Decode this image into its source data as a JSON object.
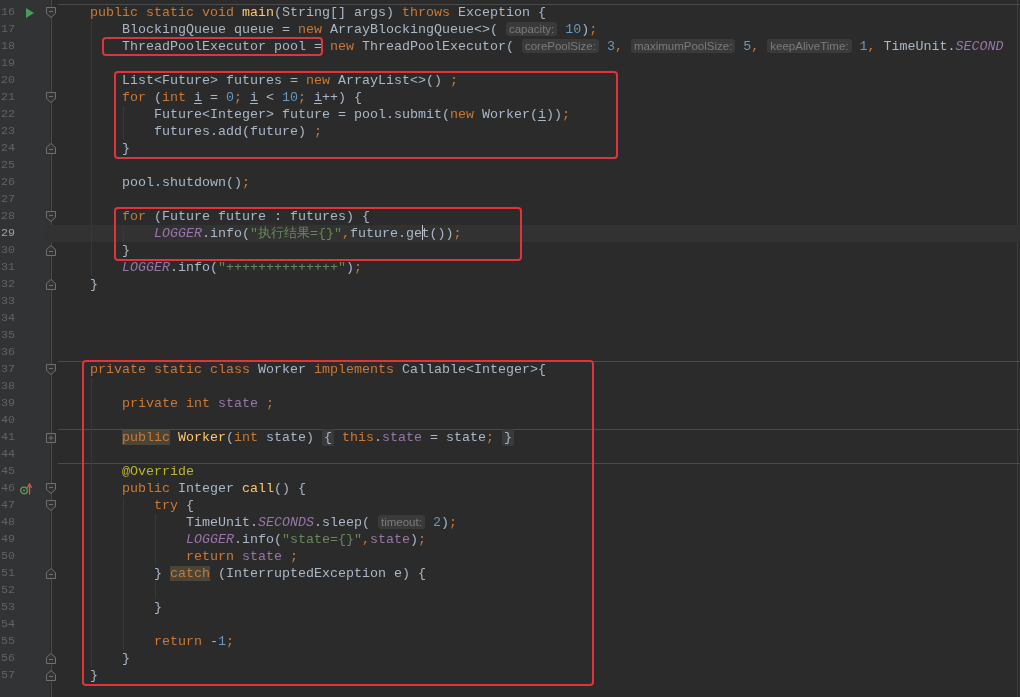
{
  "editor": {
    "lines": [
      {
        "kind": "line",
        "number": "16",
        "separator_above": true,
        "gutter_marker": {
          "kind": "run"
        },
        "fold_marker": {
          "kind": "start"
        },
        "tokens": [
          {
            "text": "public static void ",
            "kind": "keyword"
          },
          {
            "text": "main",
            "kind": "method"
          },
          {
            "text": "(String[] args) ",
            "kind": "plain"
          },
          {
            "text": "throws",
            "kind": "keyword"
          },
          {
            "text": " Exception {",
            "kind": "plain"
          }
        ],
        "children": [
          {
            "kind": "line",
            "number": "17",
            "tokens": [
              {
                "text": "BlockingQueue queue = ",
                "kind": "plain"
              },
              {
                "text": "new",
                "kind": "keyword"
              },
              {
                "text": " ArrayBlockingQueue<>( ",
                "kind": "plain"
              },
              {
                "text": "capacity:",
                "kind": "hint"
              },
              {
                "text": " 10",
                "kind": "number"
              },
              {
                "text": ")",
                "kind": "plain"
              },
              {
                "text": ";",
                "kind": "punct"
              }
            ]
          },
          {
            "kind": "line",
            "number": "18",
            "tokens": [
              {
                "text": "ThreadPoolExecutor pool =",
                "kind": "plain",
                "framed": true
              },
              {
                "text": " new",
                "kind": "keyword"
              },
              {
                "text": " ThreadPoolExecutor( ",
                "kind": "plain"
              },
              {
                "text": "corePoolSize:",
                "kind": "hint"
              },
              {
                "text": " 3",
                "kind": "number"
              },
              {
                "text": ", ",
                "kind": "punct"
              },
              {
                "text": "maximumPoolSize:",
                "kind": "hint"
              },
              {
                "text": " 5",
                "kind": "number"
              },
              {
                "text": ", ",
                "kind": "punct"
              },
              {
                "text": "keepAliveTime:",
                "kind": "hint"
              },
              {
                "text": " 1",
                "kind": "number"
              },
              {
                "text": ",",
                "kind": "punct"
              },
              {
                "text": " TimeUnit.",
                "kind": "plain"
              },
              {
                "text": "SECOND",
                "kind": "static"
              }
            ]
          },
          {
            "kind": "line",
            "number": "19"
          },
          {
            "kind": "frame",
            "children": [
              {
                "kind": "line",
                "number": "20",
                "tokens": [
                  {
                    "text": "List<Future> futures = ",
                    "kind": "plain"
                  },
                  {
                    "text": "new",
                    "kind": "keyword"
                  },
                  {
                    "text": " ArrayList<>() ",
                    "kind": "plain"
                  },
                  {
                    "text": ";",
                    "kind": "punct"
                  }
                ]
              },
              {
                "kind": "line",
                "number": "21",
                "fold_marker": {
                  "kind": "start"
                },
                "tokens": [
                  {
                    "text": "for",
                    "kind": "keyword"
                  },
                  {
                    "text": " (",
                    "kind": "plain"
                  },
                  {
                    "text": "int ",
                    "kind": "keyword"
                  },
                  {
                    "text": "i",
                    "kind": "reassigned"
                  },
                  {
                    "text": " = ",
                    "kind": "plain"
                  },
                  {
                    "text": "0",
                    "kind": "number"
                  },
                  {
                    "text": "; ",
                    "kind": "punct"
                  },
                  {
                    "text": "i",
                    "kind": "reassigned"
                  },
                  {
                    "text": " < ",
                    "kind": "plain"
                  },
                  {
                    "text": "10",
                    "kind": "number"
                  },
                  {
                    "text": "; ",
                    "kind": "punct"
                  },
                  {
                    "text": "i",
                    "kind": "reassigned"
                  },
                  {
                    "text": "++) {",
                    "kind": "plain"
                  }
                ],
                "children": [
                  {
                    "kind": "line",
                    "number": "22",
                    "tokens": [
                      {
                        "text": "Future<Integer> future = pool.submit(",
                        "kind": "plain"
                      },
                      {
                        "text": "new",
                        "kind": "keyword"
                      },
                      {
                        "text": " Worker(",
                        "kind": "plain"
                      },
                      {
                        "text": "i",
                        "kind": "reassigned"
                      },
                      {
                        "text": "))",
                        "kind": "plain"
                      },
                      {
                        "text": ";",
                        "kind": "punct"
                      }
                    ]
                  },
                  {
                    "kind": "line",
                    "number": "23",
                    "tokens": [
                      {
                        "text": "futures.add(future) ",
                        "kind": "plain"
                      },
                      {
                        "text": ";",
                        "kind": "punct"
                      }
                    ]
                  }
                ]
              },
              {
                "kind": "line",
                "number": "24",
                "fold_marker": {
                  "kind": "end"
                },
                "tokens": [
                  {
                    "text": "}",
                    "kind": "plain"
                  }
                ]
              }
            ]
          },
          {
            "kind": "line",
            "number": "25"
          },
          {
            "kind": "line",
            "number": "26",
            "tokens": [
              {
                "text": "pool.shutdown()",
                "kind": "plain"
              },
              {
                "text": ";",
                "kind": "punct"
              }
            ]
          },
          {
            "kind": "line",
            "number": "27"
          },
          {
            "kind": "frame",
            "children": [
              {
                "kind": "line",
                "number": "28",
                "fold_marker": {
                  "kind": "start"
                },
                "tokens": [
                  {
                    "text": "for",
                    "kind": "keyword"
                  },
                  {
                    "text": " (Future future : futures) {",
                    "kind": "plain"
                  }
                ],
                "children": [
                  {
                    "kind": "line",
                    "number": "29",
                    "current": true,
                    "tokens": [
                      {
                        "text": "LOGGER",
                        "kind": "static"
                      },
                      {
                        "text": ".info(",
                        "kind": "plain"
                      },
                      {
                        "text": "\"执行结果={}\"",
                        "kind": "string"
                      },
                      {
                        "text": ",",
                        "kind": "punct"
                      },
                      {
                        "text": "future.ge",
                        "kind": "plain"
                      },
                      {
                        "kind": "caret"
                      },
                      {
                        "text": "t())",
                        "kind": "plain"
                      },
                      {
                        "text": ";",
                        "kind": "punct"
                      }
                    ]
                  }
                ]
              },
              {
                "kind": "line",
                "number": "30",
                "fold_marker": {
                  "kind": "end"
                },
                "tokens": [
                  {
                    "text": "}",
                    "kind": "plain"
                  }
                ]
              }
            ]
          },
          {
            "kind": "line",
            "number": "31",
            "tokens": [
              {
                "text": "LOGGER",
                "kind": "static"
              },
              {
                "text": ".info(",
                "kind": "plain"
              },
              {
                "text": "\"++++++++++++++\"",
                "kind": "string"
              },
              {
                "text": ")",
                "kind": "plain"
              },
              {
                "text": ";",
                "kind": "punct"
              }
            ]
          }
        ]
      },
      {
        "kind": "line",
        "number": "32",
        "fold_marker": {
          "kind": "end"
        },
        "tokens": [
          {
            "text": "}",
            "kind": "plain"
          }
        ]
      },
      {
        "kind": "line",
        "number": "33"
      },
      {
        "kind": "line",
        "number": "34"
      },
      {
        "kind": "line",
        "number": "35"
      },
      {
        "kind": "line",
        "number": "36"
      },
      {
        "kind": "frame",
        "children": [
          {
            "kind": "line",
            "number": "37",
            "separator_above": true,
            "fold_marker": {
              "kind": "start"
            },
            "tokens": [
              {
                "text": "private static class ",
                "kind": "keyword"
              },
              {
                "text": "Worker ",
                "kind": "plain"
              },
              {
                "text": "implements",
                "kind": "keyword"
              },
              {
                "text": " Callable<Integer>{",
                "kind": "plain"
              }
            ],
            "children": [
              {
                "kind": "line",
                "number": "38"
              },
              {
                "kind": "line",
                "number": "39",
                "tokens": [
                  {
                    "text": "private int ",
                    "kind": "keyword"
                  },
                  {
                    "text": "state",
                    "kind": "field"
                  },
                  {
                    "text": " ;",
                    "kind": "punct"
                  }
                ]
              },
              {
                "kind": "line",
                "number": "40"
              },
              {
                "kind": "line",
                "number": "41",
                "separator_above": true,
                "fold_marker": {
                  "kind": "collapsed"
                },
                "tokens": [
                  {
                    "text": "public",
                    "kind": "keyword",
                    "highlighted": true
                  },
                  {
                    "text": " Worker",
                    "kind": "method"
                  },
                  {
                    "text": "(",
                    "kind": "plain"
                  },
                  {
                    "text": "int",
                    "kind": "keyword"
                  },
                  {
                    "text": " state) ",
                    "kind": "plain"
                  },
                  {
                    "text": "{",
                    "kind": "fold"
                  },
                  {
                    "text": " this",
                    "kind": "keyword"
                  },
                  {
                    "text": ".",
                    "kind": "plain"
                  },
                  {
                    "text": "state",
                    "kind": "field"
                  },
                  {
                    "text": " = state",
                    "kind": "plain"
                  },
                  {
                    "text": "; ",
                    "kind": "punct"
                  },
                  {
                    "text": "}",
                    "kind": "fold"
                  }
                ]
              },
              {
                "kind": "line",
                "number": "44"
              },
              {
                "kind": "line",
                "number": "45",
                "separator_above": true,
                "tokens": [
                  {
                    "text": "@Override",
                    "kind": "annotation"
                  }
                ]
              },
              {
                "kind": "line",
                "number": "46",
                "gutter_marker": {
                  "kind": "override"
                },
                "fold_marker": {
                  "kind": "start"
                },
                "tokens": [
                  {
                    "text": "public",
                    "kind": "keyword"
                  },
                  {
                    "text": " Integer ",
                    "kind": "plain"
                  },
                  {
                    "text": "call",
                    "kind": "method"
                  },
                  {
                    "text": "() {",
                    "kind": "plain"
                  }
                ],
                "children": [
                  {
                    "kind": "line",
                    "number": "47",
                    "fold_marker": {
                      "kind": "start"
                    },
                    "tokens": [
                      {
                        "text": "try",
                        "kind": "keyword"
                      },
                      {
                        "text": " {",
                        "kind": "plain"
                      }
                    ],
                    "children": [
                      {
                        "kind": "line",
                        "number": "48",
                        "tokens": [
                          {
                            "text": "TimeUnit.",
                            "kind": "plain"
                          },
                          {
                            "text": "SECONDS",
                            "kind": "static"
                          },
                          {
                            "text": ".sleep( ",
                            "kind": "plain"
                          },
                          {
                            "text": "timeout:",
                            "kind": "hint"
                          },
                          {
                            "text": " 2",
                            "kind": "number"
                          },
                          {
                            "text": ")",
                            "kind": "plain"
                          },
                          {
                            "text": ";",
                            "kind": "punct"
                          }
                        ]
                      },
                      {
                        "kind": "line",
                        "number": "49",
                        "tokens": [
                          {
                            "text": "LOGGER",
                            "kind": "static"
                          },
                          {
                            "text": ".info(",
                            "kind": "plain"
                          },
                          {
                            "text": "\"state={}\"",
                            "kind": "string"
                          },
                          {
                            "text": ",",
                            "kind": "punct"
                          },
                          {
                            "text": "state",
                            "kind": "field"
                          },
                          {
                            "text": ")",
                            "kind": "plain"
                          },
                          {
                            "text": ";",
                            "kind": "punct"
                          }
                        ]
                      },
                      {
                        "kind": "line",
                        "number": "50",
                        "tokens": [
                          {
                            "text": "return ",
                            "kind": "keyword"
                          },
                          {
                            "text": "state",
                            "kind": "field"
                          },
                          {
                            "text": " ;",
                            "kind": "punct"
                          }
                        ]
                      }
                    ]
                  },
                  {
                    "kind": "line",
                    "number": "51",
                    "fold_marker": {
                      "kind": "end"
                    },
                    "tokens": [
                      {
                        "text": "} ",
                        "kind": "plain"
                      },
                      {
                        "text": "catch",
                        "kind": "keyword",
                        "highlighted": true
                      },
                      {
                        "text": " (InterruptedException e) {",
                        "kind": "plain"
                      }
                    ],
                    "children": [
                      {
                        "kind": "line",
                        "number": "52"
                      }
                    ]
                  },
                  {
                    "kind": "line",
                    "number": "53",
                    "tokens": [
                      {
                        "text": "}",
                        "kind": "plain"
                      }
                    ]
                  },
                  {
                    "kind": "line",
                    "number": "54"
                  },
                  {
                    "kind": "line",
                    "number": "55",
                    "tokens": [
                      {
                        "text": "return ",
                        "kind": "keyword"
                      },
                      {
                        "text": "-",
                        "kind": "plain"
                      },
                      {
                        "text": "1",
                        "kind": "number"
                      },
                      {
                        "text": ";",
                        "kind": "punct"
                      }
                    ]
                  }
                ]
              },
              {
                "kind": "line",
                "number": "56",
                "fold_marker": {
                  "kind": "end"
                },
                "tokens": [
                  {
                    "text": "}",
                    "kind": "plain"
                  }
                ]
              }
            ]
          },
          {
            "kind": "line",
            "number": "57",
            "fold_marker": {
              "kind": "end"
            },
            "tokens": [
              {
                "text": "}",
                "kind": "plain"
              }
            ]
          }
        ]
      }
    ]
  }
}
